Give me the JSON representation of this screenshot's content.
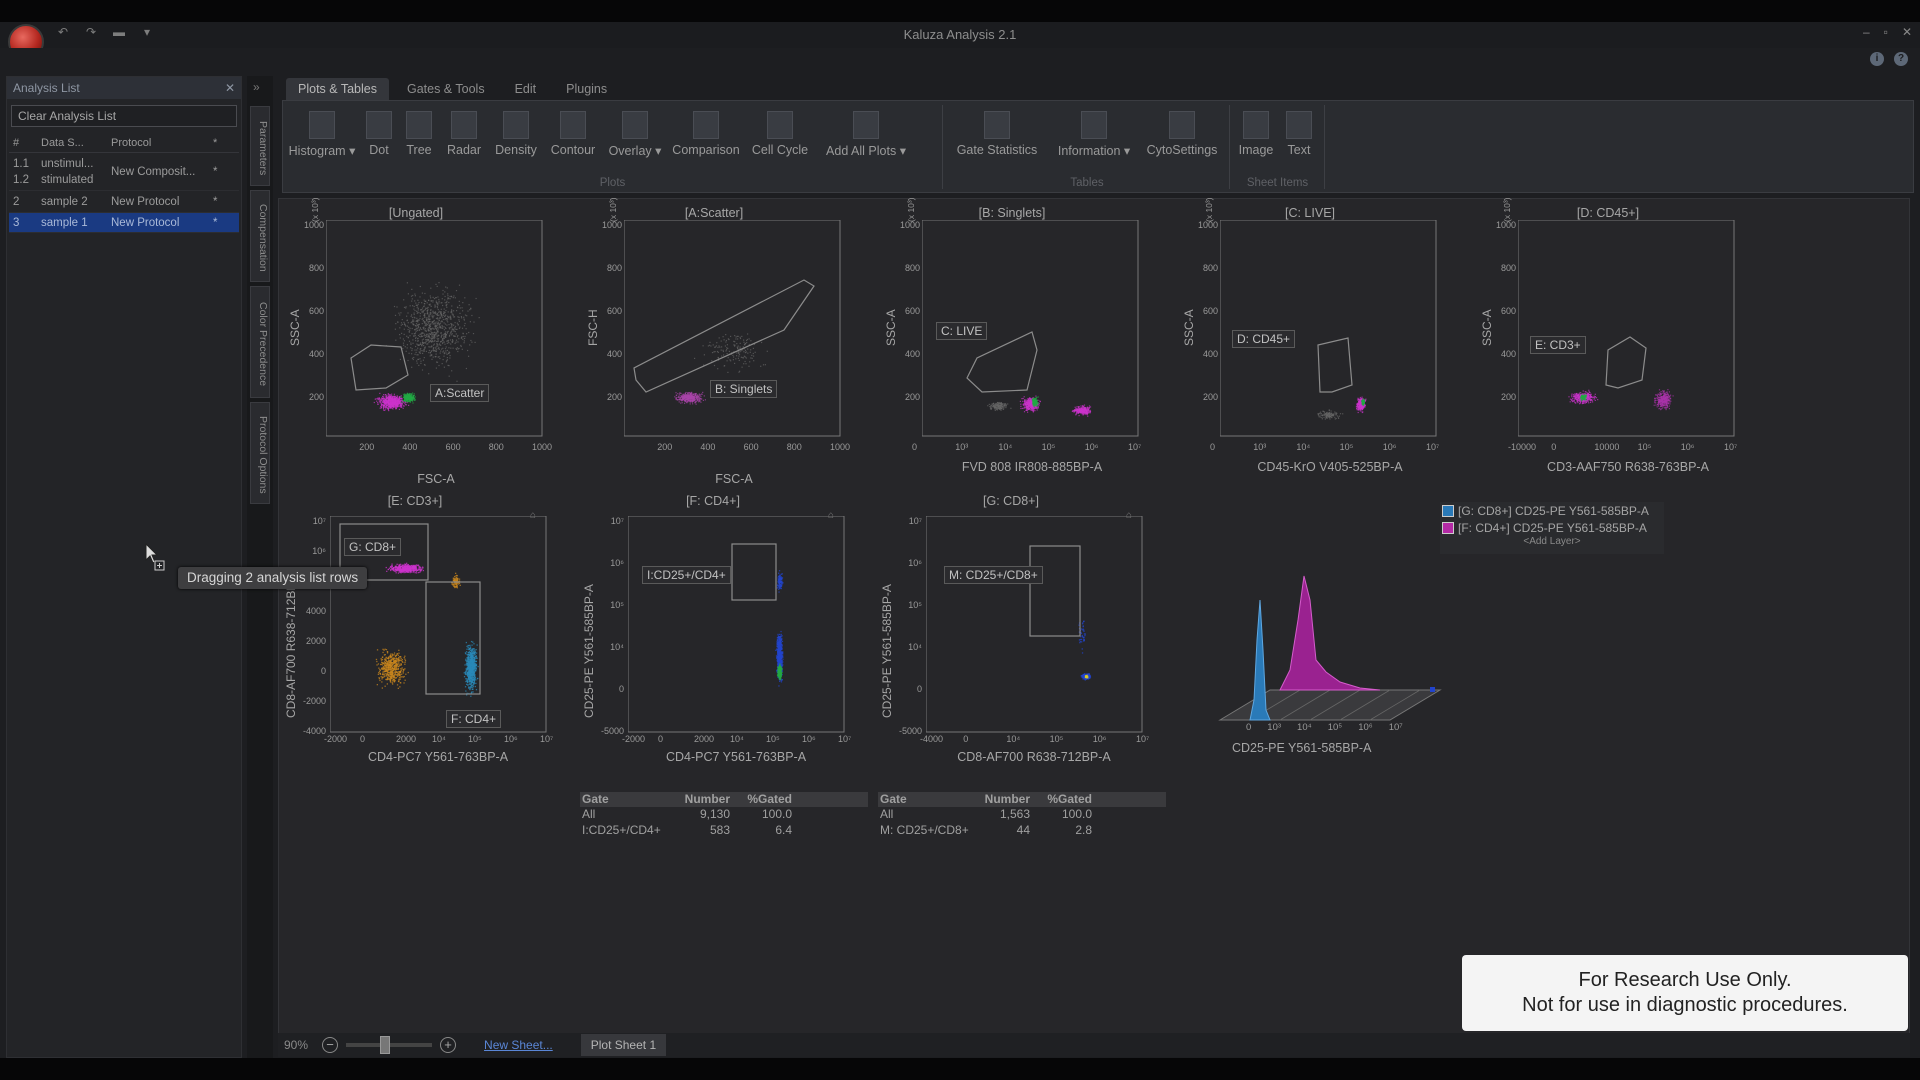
{
  "window": {
    "title": "Kaluza Analysis 2.1"
  },
  "quick_access": [
    "↶",
    "↷",
    "▬",
    "▾"
  ],
  "window_controls": [
    "–",
    "▫",
    "✕"
  ],
  "help_icons": [
    "i",
    "?"
  ],
  "analysis_list": {
    "title": "Analysis List",
    "clear_button": "Clear Analysis List",
    "columns": {
      "num": "#",
      "dataset": "Data S...",
      "protocol": "Protocol",
      "star": "*"
    },
    "rows": [
      {
        "num": "1.1",
        "dataset": "unstimul...",
        "protocol": "New Composit...",
        "star": "*",
        "num2": "1.2",
        "dataset2": "stimulated"
      },
      {
        "num": "2",
        "dataset": "sample 2",
        "protocol": "New Protocol",
        "star": "*"
      },
      {
        "num": "3",
        "dataset": "sample 1",
        "protocol": "New Protocol",
        "star": "*"
      }
    ]
  },
  "side_tabs": [
    "Parameters",
    "Compensation",
    "Color Precedence",
    "Protocol Options"
  ],
  "ribbon_tabs": [
    "Plots & Tables",
    "Gates & Tools",
    "Edit",
    "Plugins"
  ],
  "ribbon": {
    "plots": [
      "Histogram",
      "Dot",
      "Tree",
      "Radar",
      "Density",
      "Contour",
      "Overlay",
      "Comparison",
      "Cell Cycle",
      "Add All Plots"
    ],
    "tables": [
      "Gate Statistics",
      "Information",
      "CytoSettings"
    ],
    "sheet_items": [
      "Image",
      "Text"
    ],
    "group_labels": {
      "plots": "Plots",
      "tables": "Tables",
      "sheet_items": "Sheet Items"
    }
  },
  "plots_row1": [
    {
      "title": "[Ungated]",
      "xlabel": "FSC-A",
      "ylabel": "SSC-A",
      "gate": "A:Scatter",
      "xticks": [
        "200",
        "400",
        "600",
        "800",
        "1000"
      ],
      "yticks": [
        "1000",
        "800",
        "600",
        "400",
        "200"
      ],
      "exp": "(x 10³)"
    },
    {
      "title": "[A:Scatter]",
      "xlabel": "FSC-A",
      "ylabel": "FSC-H",
      "gate": "B: Singlets",
      "xticks": [
        "200",
        "400",
        "600",
        "800",
        "1000"
      ],
      "yticks": [
        "1000",
        "800",
        "600",
        "400",
        "200"
      ],
      "exp": "(x 10³)"
    },
    {
      "title": "[B: Singlets]",
      "xlabel": "FVD 808 IR808-885BP-A",
      "ylabel": "SSC-A",
      "gate": "C: LIVE",
      "xticks": [
        "0",
        "10³",
        "10⁴",
        "10⁵",
        "10⁶",
        "10⁷"
      ],
      "yticks": [
        "1000",
        "800",
        "600",
        "400",
        "200"
      ],
      "exp": "(x 10³)"
    },
    {
      "title": "[C: LIVE]",
      "xlabel": "CD45-KrO V405-525BP-A",
      "ylabel": "SSC-A",
      "gate": "D: CD45+",
      "xticks": [
        "0",
        "10³",
        "10⁴",
        "10⁵",
        "10⁶",
        "10⁷"
      ],
      "yticks": [
        "1000",
        "800",
        "600",
        "400",
        "200"
      ],
      "exp": "(x 10³)"
    },
    {
      "title": "[D: CD45+]",
      "xlabel": "CD3-AAF750 R638-763BP-A",
      "ylabel": "SSC-A",
      "gate": "E: CD3+",
      "xticks": [
        "-10000",
        "0",
        "10000",
        "10⁵",
        "10⁶",
        "10⁷"
      ],
      "yticks": [
        "1000",
        "800",
        "600",
        "400",
        "200"
      ],
      "exp": "(x 10³)"
    }
  ],
  "plots_row2": [
    {
      "title": "[E: CD3+]",
      "xlabel": "CD4-PC7 Y561-763BP-A",
      "ylabel": "CD8-AF700 R638-712BP-A",
      "gates": [
        "G: CD8+",
        "F: CD4+"
      ],
      "xticks": [
        "-2000",
        "0",
        "2000",
        "10⁴",
        "10⁵",
        "10⁶",
        "10⁷"
      ],
      "yticks": [
        "10⁷",
        "10⁶",
        "10⁵",
        "4000",
        "2000",
        "0",
        "-2000",
        "-4000"
      ]
    },
    {
      "title": "[F: CD4+]",
      "xlabel": "CD4-PC7 Y561-763BP-A",
      "ylabel": "CD25-PE Y561-585BP-A",
      "gates": [
        "I:CD25+/CD4+"
      ],
      "xticks": [
        "-2000",
        "0",
        "2000",
        "10⁴",
        "10⁵",
        "10⁶",
        "10⁷"
      ],
      "yticks": [
        "10⁷",
        "10⁶",
        "10⁵",
        "10⁴",
        "0",
        "-5000"
      ]
    },
    {
      "title": "[G: CD8+]",
      "xlabel": "CD8-AF700 R638-712BP-A",
      "ylabel": "CD25-PE Y561-585BP-A",
      "gates": [
        "M: CD25+/CD8+"
      ],
      "xticks": [
        "-4000",
        "0",
        "10⁴",
        "10⁵",
        "10⁶",
        "10⁷"
      ],
      "yticks": [
        "10⁷",
        "10⁶",
        "10⁵",
        "10⁴",
        "0",
        "-5000"
      ]
    }
  ],
  "stats_f": {
    "headers": [
      "Gate",
      "Number",
      "%Gated"
    ],
    "rows": [
      [
        "All",
        "9,130",
        "100.0"
      ],
      [
        "I:CD25+/CD4+",
        "583",
        "6.4"
      ]
    ]
  },
  "stats_g": {
    "headers": [
      "Gate",
      "Number",
      "%Gated"
    ],
    "rows": [
      [
        "All",
        "1,563",
        "100.0"
      ],
      [
        "M: CD25+/CD8+",
        "44",
        "2.8"
      ]
    ]
  },
  "overlay": {
    "legend": [
      {
        "label": "[G: CD8+] CD25-PE Y561-585BP-A",
        "color": "#2a7ab8"
      },
      {
        "label": "[F: CD4+] CD25-PE Y561-585BP-A",
        "color": "#b42aa6"
      }
    ],
    "add_layer": "<Add Layer>",
    "xlabel": "CD25-PE Y561-585BP-A",
    "xticks": [
      "0",
      "10³",
      "10⁴",
      "10⁵",
      "10⁶",
      "10⁷"
    ]
  },
  "notice": {
    "line1": "For Research Use Only.",
    "line2": "Not for use in diagnostic procedures."
  },
  "drag_tooltip": "Dragging 2 analysis list rows",
  "statusbar": {
    "zoom": "90%",
    "new_sheet": "New Sheet...",
    "sheet_tab": "Plot Sheet 1"
  }
}
